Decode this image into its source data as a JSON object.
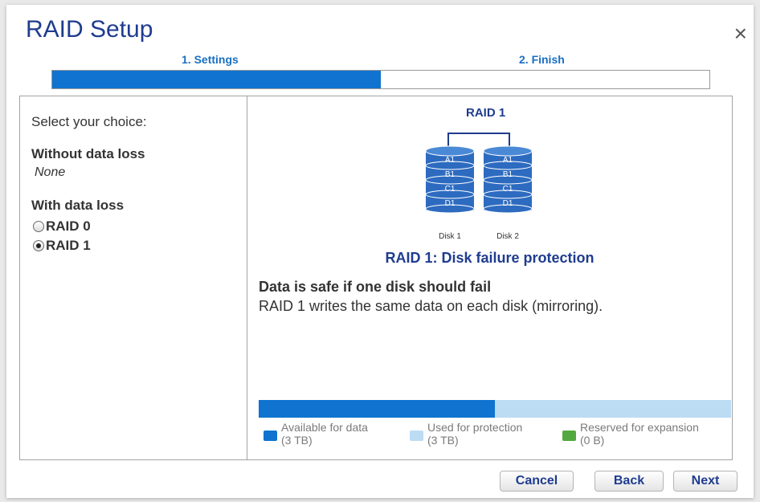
{
  "dialog": {
    "title": "RAID Setup",
    "close_label": "×"
  },
  "steps": [
    {
      "label": "1. Settings"
    },
    {
      "label": "2. Finish"
    }
  ],
  "progress": {
    "fraction": 0.5
  },
  "left_panel": {
    "prompt": "Select your choice:",
    "group1_label": "Without data loss",
    "group1_none": "None",
    "group2_label": "With data loss",
    "options": [
      {
        "label": "RAID 0",
        "selected": false
      },
      {
        "label": "RAID 1",
        "selected": true
      }
    ]
  },
  "right_panel": {
    "raid_name": "RAID 1",
    "disks": [
      {
        "label": "Disk 1",
        "blocks": [
          "A1",
          "B1",
          "C1",
          "D1"
        ]
      },
      {
        "label": "Disk 2",
        "blocks": [
          "A1",
          "B1",
          "C1",
          "D1"
        ]
      }
    ],
    "subtitle": "RAID 1: Disk failure protection",
    "headline": "Data is safe if one disk should fail",
    "description": "RAID 1 writes the same data on each disk (mirroring).",
    "capacity": {
      "available_fraction": 0.5,
      "protection_fraction": 0.5,
      "legend": [
        {
          "label": "Available for data",
          "value": "(3 TB)",
          "color": "#0f73cf"
        },
        {
          "label": "Used for protection",
          "value": "(3 TB)",
          "color": "#bcdcf4"
        },
        {
          "label": "Reserved for expansion",
          "value": "(0 B)",
          "color": "#53a93f"
        }
      ]
    }
  },
  "buttons": {
    "cancel": "Cancel",
    "back": "Back",
    "next": "Next"
  },
  "colors": {
    "accent": "#0f73cf",
    "title": "#1f3c8f",
    "disk": "#2d6bc0"
  }
}
